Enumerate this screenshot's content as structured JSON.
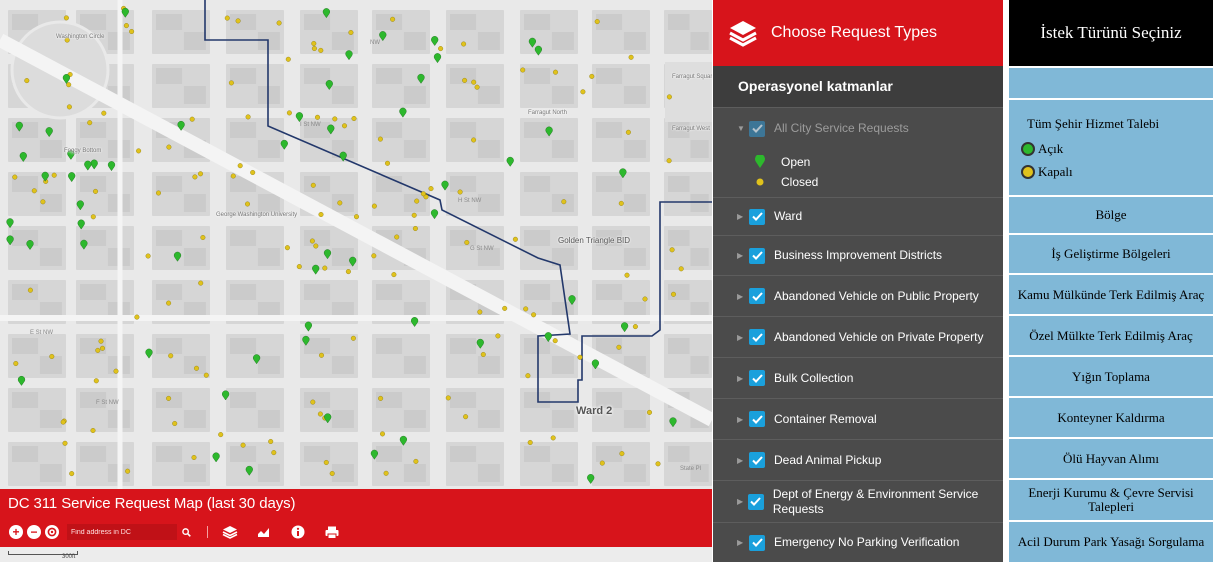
{
  "map": {
    "title": "DC 311 Service Request Map (last 30 days)",
    "address_placeholder": "Find address in DC",
    "scale_label": "300ft",
    "ward_label": "Ward 2",
    "places": {
      "washington_circle": "Washington Circle",
      "foggy_bottom": "Foggy Bottom",
      "farragut_north": "Farragut North",
      "farragut_square": "Farragut Square",
      "farragut_west": "Farragut West",
      "gwu": "George Washington University",
      "golden_triangle": "Golden Triangle BID"
    },
    "streets": {
      "k": "I St NW",
      "i": "I St NW",
      "h": "H St NW",
      "g": "G St NW",
      "f": "F St NW",
      "e": "E St NW",
      "nw": "NW",
      "kst": "K St NW",
      "state": "State Pl"
    }
  },
  "layer_panel": {
    "title": "Choose Request Types",
    "section": "Operasyonel katmanlar",
    "all_requests": "All City Service Requests",
    "legend": {
      "open": "Open",
      "closed": "Closed"
    },
    "layers": [
      "Ward",
      "Business Improvement Districts",
      "Abandoned Vehicle on Public Property",
      "Abandoned Vehicle on Private Property",
      "Bulk Collection",
      "Container Removal",
      "Dead Animal Pickup",
      "Dept of Energy & Environment Service Requests",
      "Emergency No Parking Verification"
    ]
  },
  "tr_panel": {
    "title": "İstek Türünü Seçiniz",
    "all_requests": "Tüm Şehir Hizmet Talebi",
    "legend": {
      "open": "Açık",
      "closed": "Kapalı"
    },
    "items": [
      "Bölge",
      "İş Geliştirme Bölgeleri",
      "Kamu Mülkünde Terk Edilmiş Araç",
      "Özel Mülkte Terk Edilmiş Araç",
      "Yığın Toplama",
      "Konteyner Kaldırma",
      "Ölü Hayvan Alımı",
      "Enerji Kurumu & Çevre Servisi Talepleri",
      "Acil Durum Park Yasağı Sorgulama"
    ]
  },
  "colors": {
    "brand_red": "#d7141b",
    "panel_dark": "#4b4b4b",
    "check_blue": "#1aa0dc",
    "tr_cell_blue": "#80b8d7",
    "open_green": "#2db82d",
    "closed_yellow": "#e0c21c",
    "ward_line": "#23386b"
  }
}
